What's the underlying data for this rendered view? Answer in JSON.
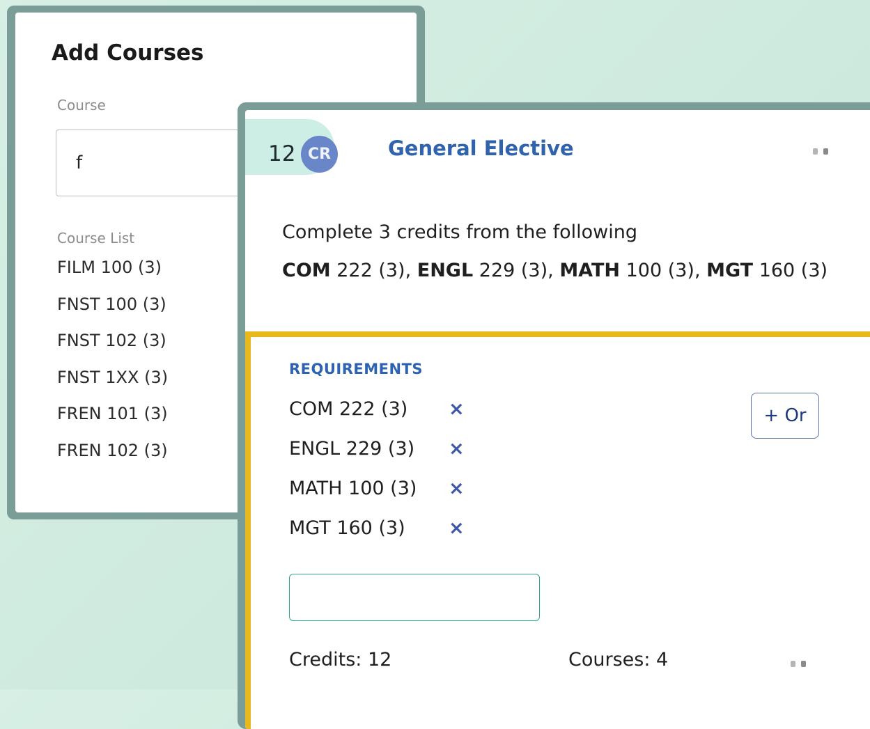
{
  "add_courses": {
    "title": "Add Courses",
    "course_field_label": "Course",
    "course_input_value": "f",
    "course_list_label": "Course List",
    "course_list": [
      "FILM 100 (3)",
      "FNST 100 (3)",
      "FNST 102 (3)",
      "FNST 1XX (3)",
      "FREN 101 (3)",
      "FREN 102 (3)"
    ]
  },
  "card": {
    "credits": "12",
    "credit_badge": "CR",
    "title": "General Elective",
    "rule_text": "Complete 3 credits from the following",
    "rule_courses": [
      {
        "subject": "COM",
        "rest": " 222 (3), "
      },
      {
        "subject": "ENGL",
        "rest": " 229 (3), "
      },
      {
        "subject": "MATH",
        "rest": " 100 (3), "
      },
      {
        "subject": "MGT",
        "rest": " 160 (3)"
      }
    ],
    "requirements_heading": "REQUIREMENTS",
    "requirements": [
      {
        "name": "COM 222 (3)",
        "remove": "×"
      },
      {
        "name": "ENGL 229 (3)",
        "remove": "×"
      },
      {
        "name": "MATH 100 (3)",
        "remove": "×"
      },
      {
        "name": "MGT 160 (3)",
        "remove": "×"
      }
    ],
    "or_button": "+ Or",
    "requirement_input_value": "",
    "footer_credits": "Credits: 12",
    "footer_courses": "Courses: 4"
  },
  "colors": {
    "accent_blue": "#2f63ae",
    "badge_blue": "#6987c8",
    "highlight_yellow": "#e7b91c",
    "input_green": "#2fa58d",
    "frame": "#7a9d97"
  }
}
